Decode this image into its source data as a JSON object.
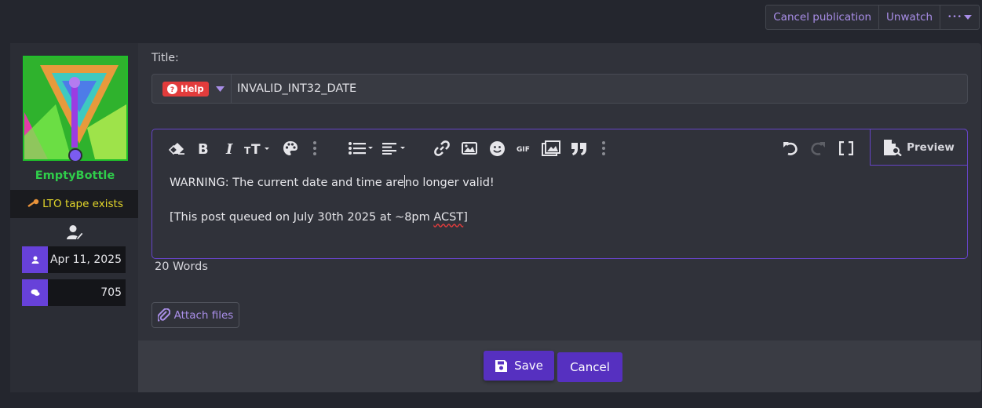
{
  "topbar": {
    "cancel_publication": "Cancel publication",
    "unwatch": "Unwatch",
    "more": "•••"
  },
  "user": {
    "name": "EmptyBottle",
    "title": "LTO tape exists",
    "joined": "Apr 11, 2025",
    "messages": "705",
    "colors": {
      "username": "#2fcc4a",
      "title": "#e3d62a",
      "stat_icon_bg": "#6741d9"
    }
  },
  "form": {
    "title_label": "Title:",
    "prefix": "Help",
    "title_value": "INVALID_INT32_DATE",
    "body_line1_a": "WARNING: The current date and time are",
    "body_line1_b": "no longer valid!",
    "body_line2_a": "[This post queued on July 30th 2025 at ~8pm ",
    "body_line2_spell": "ACST",
    "body_line2_b": "]",
    "word_count": "20 Words",
    "preview": "Preview",
    "attach": "Attach files",
    "save": "Save",
    "cancel": "Cancel"
  },
  "toolbar_icons": [
    "eraser-icon",
    "bold-icon",
    "italic-icon",
    "text-size-icon",
    "palette-icon",
    "more-vertical-icon",
    "list-icon",
    "align-icon",
    "link-icon",
    "image-icon",
    "smiley-icon",
    "gif-icon",
    "media-icon",
    "quote-icon",
    "more-vertical-icon",
    "undo-icon",
    "redo-icon",
    "bbcode-toggle-icon"
  ],
  "accent": "#6644c7"
}
